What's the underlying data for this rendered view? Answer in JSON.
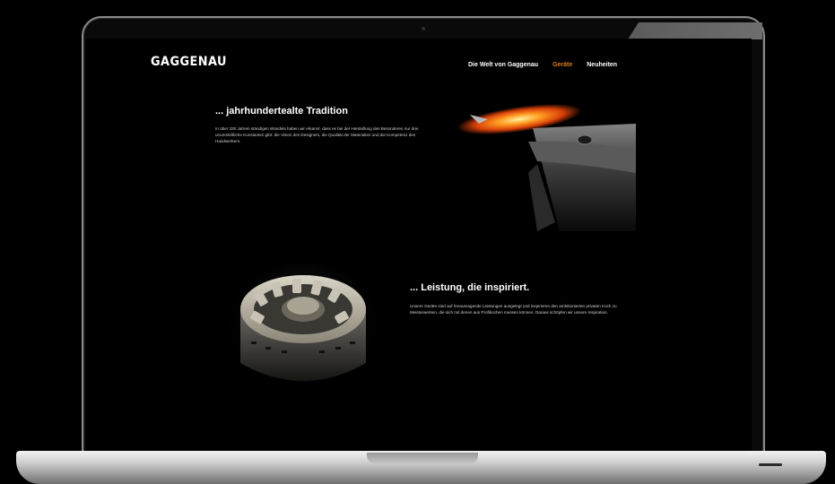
{
  "site": {
    "logo": "GAGGENAU",
    "nav": [
      {
        "label": "Die Welt von Gaggenau",
        "active": false
      },
      {
        "label": "Geräte",
        "active": true
      },
      {
        "label": "Neuheiten",
        "active": false
      }
    ]
  },
  "sections": [
    {
      "heading": "... jahrhundertealte Tradition",
      "text": "In über 330 Jahren ständigen Wandels haben wir erkannt, dass es bei der Herstellung des Besonderen nur drei unumstößliche Konstanten gibt: die Vision des Designers, die Qualität der Materialien und die Kompetenz des Handwerkers."
    },
    {
      "heading": "... Leistung, die inspiriert.",
      "text": "Unsere Geräte sind auf herausragende Leistungen ausgelegt und inspirieren den ambitionierten privaten Koch zu Meisterwerken, die sich mit denen aus Profiküchen messen können. Daraus schöpfen wir unsere Inspiration."
    }
  ],
  "colors": {
    "accent": "#e07a1a",
    "background": "#000000",
    "text": "#ffffff"
  }
}
